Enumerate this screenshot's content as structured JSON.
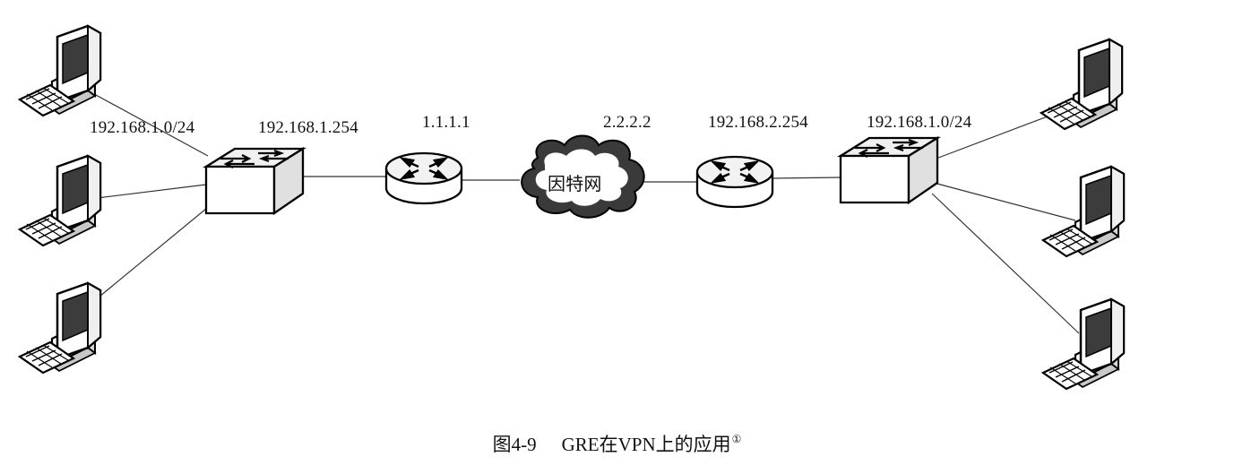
{
  "labels": {
    "left_subnet": "192.168.1.0/24",
    "left_gateway": "192.168.1.254",
    "left_router_ip": "1.1.1.1",
    "right_router_ip": "2.2.2.2",
    "right_gateway": "192.168.2.254",
    "right_subnet": "192.168.1.0/24",
    "internet": "因特网"
  },
  "caption": {
    "number": "图4-9",
    "title": "GRE在VPN上的应用",
    "footnote": "①"
  }
}
